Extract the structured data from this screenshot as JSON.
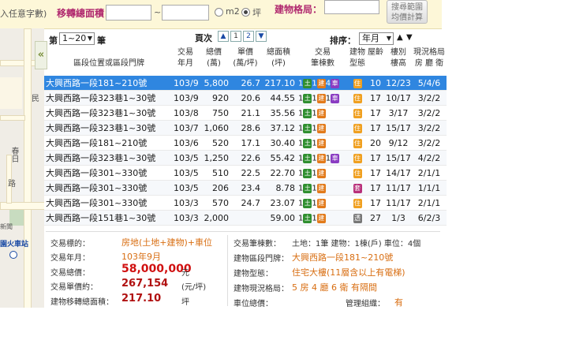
{
  "topbar": {
    "hint_text": "入任意字數)",
    "area_label": "移轉總面積：",
    "area_from": "",
    "area_to": "",
    "tilde": "~",
    "unit_m2": "m2",
    "unit_ping": "坪",
    "layout_label": "建物格局：",
    "layout_value": "",
    "search_button_line1": "搜尋範圍",
    "search_button_line2": "均價計算"
  },
  "map": {
    "labels": [
      "民",
      "春日",
      "路",
      "園火車站",
      "新聞"
    ]
  },
  "list_controls": {
    "di_label": "第",
    "range_value": "1~20",
    "bi_label": "筆",
    "page_label": "頁次",
    "pages": [
      "1",
      "2"
    ],
    "sort_label": "排序：",
    "sort_value": "年月"
  },
  "table": {
    "headers": [
      {
        "l1": "",
        "l2": "區段位置或區段門牌"
      },
      {
        "l1": "交易",
        "l2": "年月"
      },
      {
        "l1": "總價",
        "l2": "(萬)"
      },
      {
        "l1": "單價",
        "l2": "(萬/坪)"
      },
      {
        "l1": "總面積",
        "l2": "(坪)"
      },
      {
        "l1": "交易",
        "l2": "筆棟數"
      },
      {
        "l1": "建物",
        "l2": "型態"
      },
      {
        "l1": "",
        "l2": "屋齡"
      },
      {
        "l1": "樓別",
        "l2": "樓高"
      },
      {
        "l1": "現況格局",
        "l2": "房 廳 衛"
      }
    ],
    "rows": [
      {
        "addr": "大興西路一段181~210號",
        "ym": "103/9",
        "total": "5,800",
        "unit": "26.7",
        "area": "217.10",
        "land": "1",
        "bldg": "1",
        "car": "4",
        "type": "住",
        "age": "10",
        "floor": "12/23",
        "layout": "5/4/6"
      },
      {
        "addr": "大興西路一段323巷1~30號",
        "ym": "103/9",
        "total": "920",
        "unit": "20.6",
        "area": "44.55",
        "land": "1",
        "bldg": "1",
        "car": "1",
        "type": "住",
        "age": "17",
        "floor": "10/17",
        "layout": "3/2/2"
      },
      {
        "addr": "大興西路一段323巷1~30號",
        "ym": "103/8",
        "total": "750",
        "unit": "21.1",
        "area": "35.56",
        "land": "1",
        "bldg": "1",
        "car": "",
        "type": "住",
        "age": "17",
        "floor": "3/17",
        "layout": "3/2/2"
      },
      {
        "addr": "大興西路一段323巷1~30號",
        "ym": "103/7",
        "total": "1,060",
        "unit": "28.6",
        "area": "37.12",
        "land": "1",
        "bldg": "1",
        "car": "",
        "type": "住",
        "age": "17",
        "floor": "15/17",
        "layout": "3/2/2"
      },
      {
        "addr": "大興西路一段181~210號",
        "ym": "103/6",
        "total": "520",
        "unit": "17.1",
        "area": "30.40",
        "land": "1",
        "bldg": "1",
        "car": "",
        "type": "住",
        "age": "20",
        "floor": "9/12",
        "layout": "3/2/2"
      },
      {
        "addr": "大興西路一段323巷1~30號",
        "ym": "103/5",
        "total": "1,250",
        "unit": "22.6",
        "area": "55.42",
        "land": "1",
        "bldg": "1",
        "car": "1",
        "type": "住",
        "age": "17",
        "floor": "15/17",
        "layout": "4/2/2"
      },
      {
        "addr": "大興西路一段301~330號",
        "ym": "103/5",
        "total": "510",
        "unit": "22.5",
        "area": "22.70",
        "land": "1",
        "bldg": "1",
        "car": "",
        "type": "住",
        "age": "17",
        "floor": "14/17",
        "layout": "2/1/1"
      },
      {
        "addr": "大興西路一段301~330號",
        "ym": "103/5",
        "total": "206",
        "unit": "23.4",
        "area": "8.78",
        "land": "1",
        "bldg": "1",
        "car": "",
        "type": "套",
        "age": "17",
        "floor": "11/17",
        "layout": "1/1/1"
      },
      {
        "addr": "大興西路一段301~330號",
        "ym": "103/3",
        "total": "570",
        "unit": "24.7",
        "area": "23.07",
        "land": "1",
        "bldg": "1",
        "car": "",
        "type": "住",
        "age": "17",
        "floor": "11/17",
        "layout": "2/1/1"
      },
      {
        "addr": "大興西路一段151巷1~30號",
        "ym": "103/3",
        "total": "2,000",
        "unit": "",
        "area": "59.00",
        "land": "1",
        "bldg": "1",
        "car": "",
        "type": "透",
        "age": "27",
        "floor": "1/3",
        "layout": "6/2/3"
      }
    ],
    "badge_land": "土",
    "badge_bldg": "建",
    "badge_car": "車"
  },
  "detail": {
    "target_label": "交易標的：",
    "target_value": "房地(土地+建物)+車位",
    "ym_label": "交易年月：",
    "ym_value": "103年9月",
    "total_label": "交易總價：",
    "total_value": "58,000,000",
    "total_unit": "元",
    "unit_label": "交易單價約：",
    "unit_value": "267,154",
    "unit_unit": "(元/坪)",
    "area_label": "建物移轉總面積：",
    "area_value": "217.10",
    "area_unit": "坪",
    "count_label": "交易筆棟數：",
    "count_value": "土地：1筆 建物：1棟(戶) 車位：4個",
    "addr_label": "建物區段門牌：",
    "addr_value": "大興西路一段181~210號",
    "type_label": "建物型態：",
    "type_value": "住宅大樓(11層含以上有電梯)",
    "layout_label": "建物現況格局：",
    "layout_value": "5 房 4 廳 6 衛 有隔間",
    "car_label": "車位總價：",
    "mgmt_label": "管理組織：",
    "mgmt_value": "有"
  }
}
